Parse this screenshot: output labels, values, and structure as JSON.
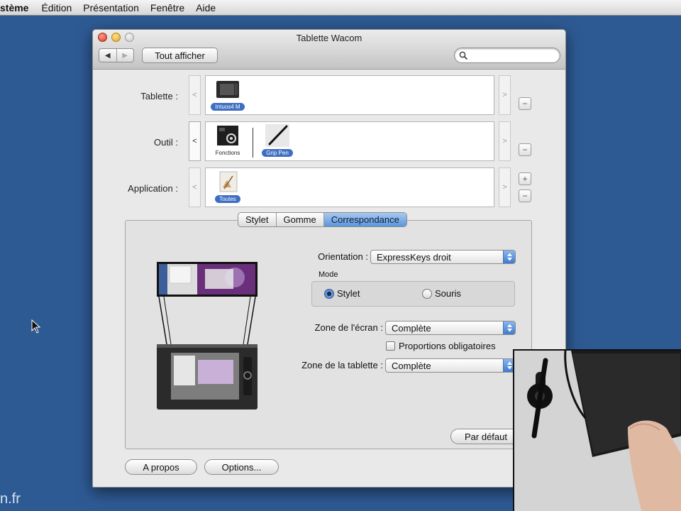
{
  "menubar": {
    "items": [
      "stème",
      "Édition",
      "Présentation",
      "Fenêtre",
      "Aide"
    ]
  },
  "window": {
    "title": "Tablette Wacom",
    "nav_back": "◀",
    "nav_forward": "▶",
    "show_all_label": "Tout afficher",
    "search_placeholder": ""
  },
  "rows": {
    "tablet": {
      "label": "Tablette :",
      "items": [
        {
          "label": "Intuos4 M",
          "selected": true
        }
      ],
      "minus": "−"
    },
    "tool": {
      "label": "Outil :",
      "items": [
        {
          "label": "Fonctions",
          "selected": false
        },
        {
          "label": "Grip Pen",
          "selected": true
        }
      ],
      "minus": "−"
    },
    "application": {
      "label": "Application :",
      "items": [
        {
          "label": "Toutes",
          "selected": true
        }
      ],
      "plus": "+",
      "minus": "−"
    },
    "arrow_left": "<",
    "arrow_right": ">"
  },
  "tabs": [
    {
      "label": "Stylet",
      "active": false
    },
    {
      "label": "Gomme",
      "active": false
    },
    {
      "label": "Correspondance",
      "active": true
    }
  ],
  "mapping": {
    "orientation_label": "Orientation :",
    "orientation_value": "ExpressKeys droit",
    "mode_label": "Mode",
    "mode_options": [
      {
        "label": "Stylet",
        "selected": true
      },
      {
        "label": "Souris",
        "selected": false
      }
    ],
    "screen_zone_label": "Zone de l'écran :",
    "screen_zone_value": "Complète",
    "proportions_label": "Proportions obligatoires",
    "proportions_checked": false,
    "tablet_zone_label": "Zone de la tablette :",
    "tablet_zone_value": "Complète",
    "default_button": "Par défaut"
  },
  "footer": {
    "about_button": "A propos",
    "options_button": "Options..."
  },
  "watermark": "n.fr",
  "colors": {
    "desktop": "#2e5a94",
    "selection": "#3f6fc2",
    "accent": "#5b95db"
  }
}
